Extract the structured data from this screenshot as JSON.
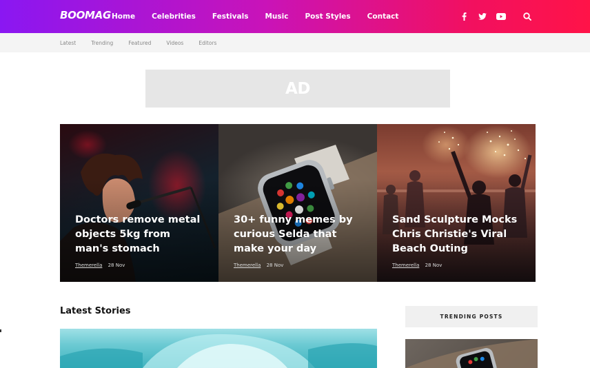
{
  "header": {
    "logo": "BOOMAG",
    "nav": [
      "Home",
      "Celebrities",
      "Festivals",
      "Music",
      "Post Styles",
      "Contact"
    ],
    "social_icons": [
      "facebook-icon",
      "twitter-icon",
      "youtube-icon"
    ],
    "search_icon": "search-icon",
    "gradient": [
      "#8a17f2",
      "#ff1348"
    ]
  },
  "subnav": [
    "Latest",
    "Trending",
    "Featured",
    "Videos",
    "Editors"
  ],
  "ad": {
    "label": "AD"
  },
  "featured": [
    {
      "title": "Doctors remove metal objects 5kg from man's stomach",
      "author": "Themerella",
      "date": "28 Nov"
    },
    {
      "title": "30+ funny memes by curious Selda that make your day",
      "author": "Themerella",
      "date": "28 Nov"
    },
    {
      "title": "Sand Sculpture Mocks Chris Christie's Viral Beach Outing",
      "author": "Themerella",
      "date": "28 Nov"
    }
  ],
  "latest": {
    "title": "Latest Stories"
  },
  "trending": {
    "title": "TRENDING POSTS"
  }
}
